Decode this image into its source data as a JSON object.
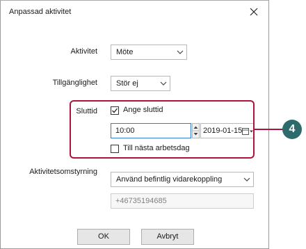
{
  "dialog": {
    "title": "Anpassad aktivitet",
    "close_icon": "close-icon"
  },
  "activity": {
    "label": "Aktivitet",
    "value": "Möte"
  },
  "availability": {
    "label": "Tillgänglighet",
    "value": "Stör ej"
  },
  "end_time": {
    "label": "Sluttid",
    "set_end_time": {
      "label": "Ange sluttid",
      "checked": true
    },
    "time": "10:00",
    "date": "2019-01-15",
    "until_next_workday": {
      "label": "Till nästa arbetsdag",
      "checked": false
    }
  },
  "redirect": {
    "label": "Aktivitetsomstyrning",
    "value": "Använd befintlig vidarekoppling",
    "number": "+46735194685"
  },
  "buttons": {
    "ok": "OK",
    "cancel": "Avbryt"
  },
  "callout": {
    "number": "4",
    "color": "#2d6a6c",
    "highlight_color": "#b0133a"
  }
}
